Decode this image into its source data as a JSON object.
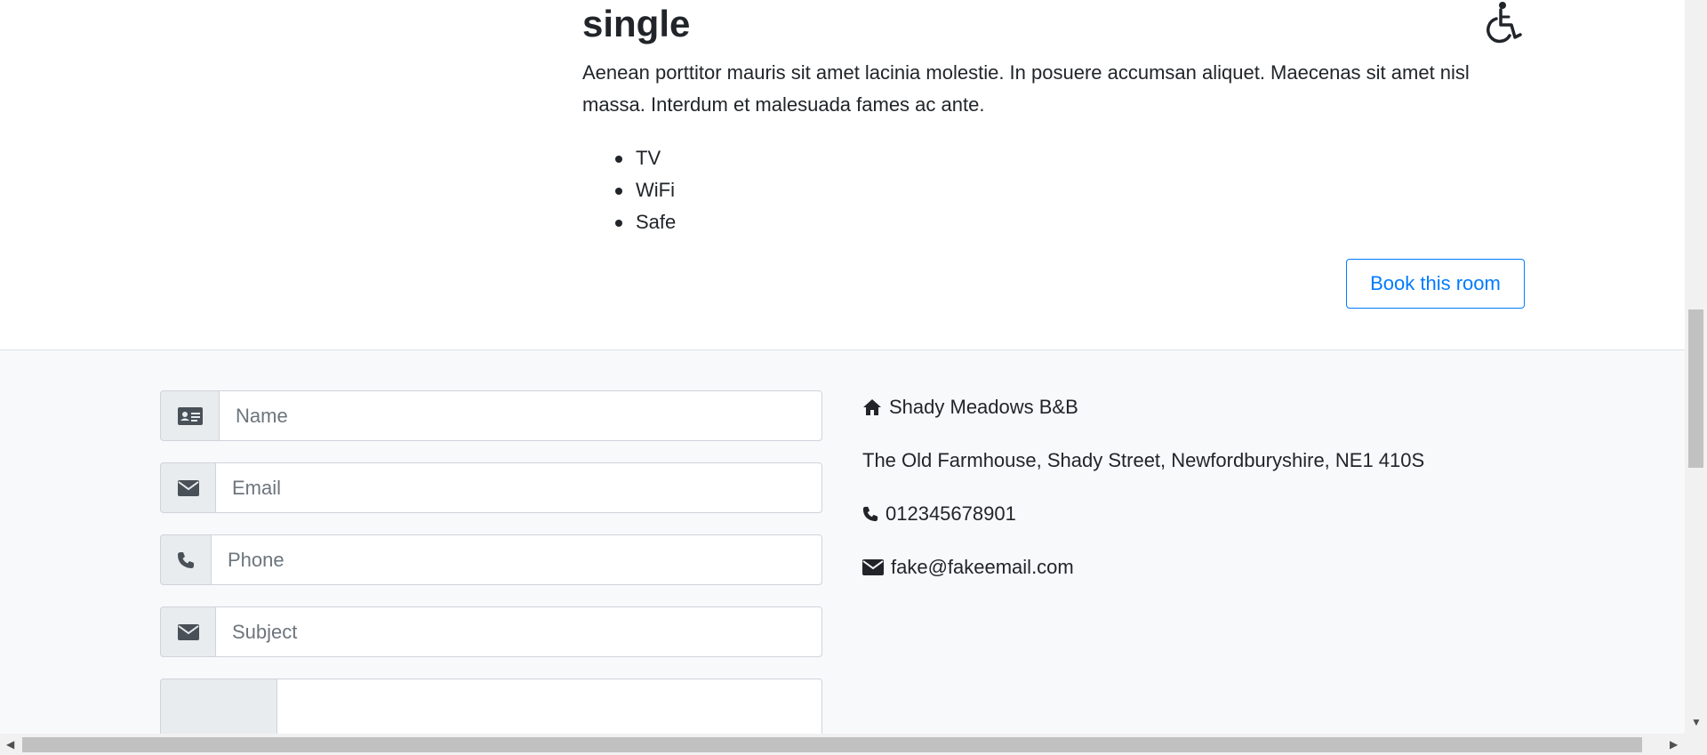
{
  "room": {
    "title": "single",
    "accessible_icon": "wheelchair-icon",
    "description": "Aenean porttitor mauris sit amet lacinia molestie. In posuere accumsan aliquet. Maecenas sit amet nisl massa. Interdum et malesuada fames ac ante.",
    "features": [
      "TV",
      "WiFi",
      "Safe"
    ],
    "book_label": "Book this room"
  },
  "contact_form": {
    "name_placeholder": "Name",
    "email_placeholder": "Email",
    "phone_placeholder": "Phone",
    "subject_placeholder": "Subject",
    "message_placeholder": "",
    "icons": [
      "id-card-icon",
      "envelope-icon",
      "phone-icon",
      "envelope-icon"
    ]
  },
  "contact_info": {
    "name": "Shady Meadows B&B",
    "address": "The Old Farmhouse, Shady Street, Newfordburyshire, NE1 410S",
    "phone": "012345678901",
    "email": "fake@fakeemail.com"
  },
  "colors": {
    "accent": "#007bff",
    "text": "#212529",
    "placeholder": "#6c757d",
    "addon_bg": "#e9ecef",
    "section_bg": "#f8f9fb"
  }
}
